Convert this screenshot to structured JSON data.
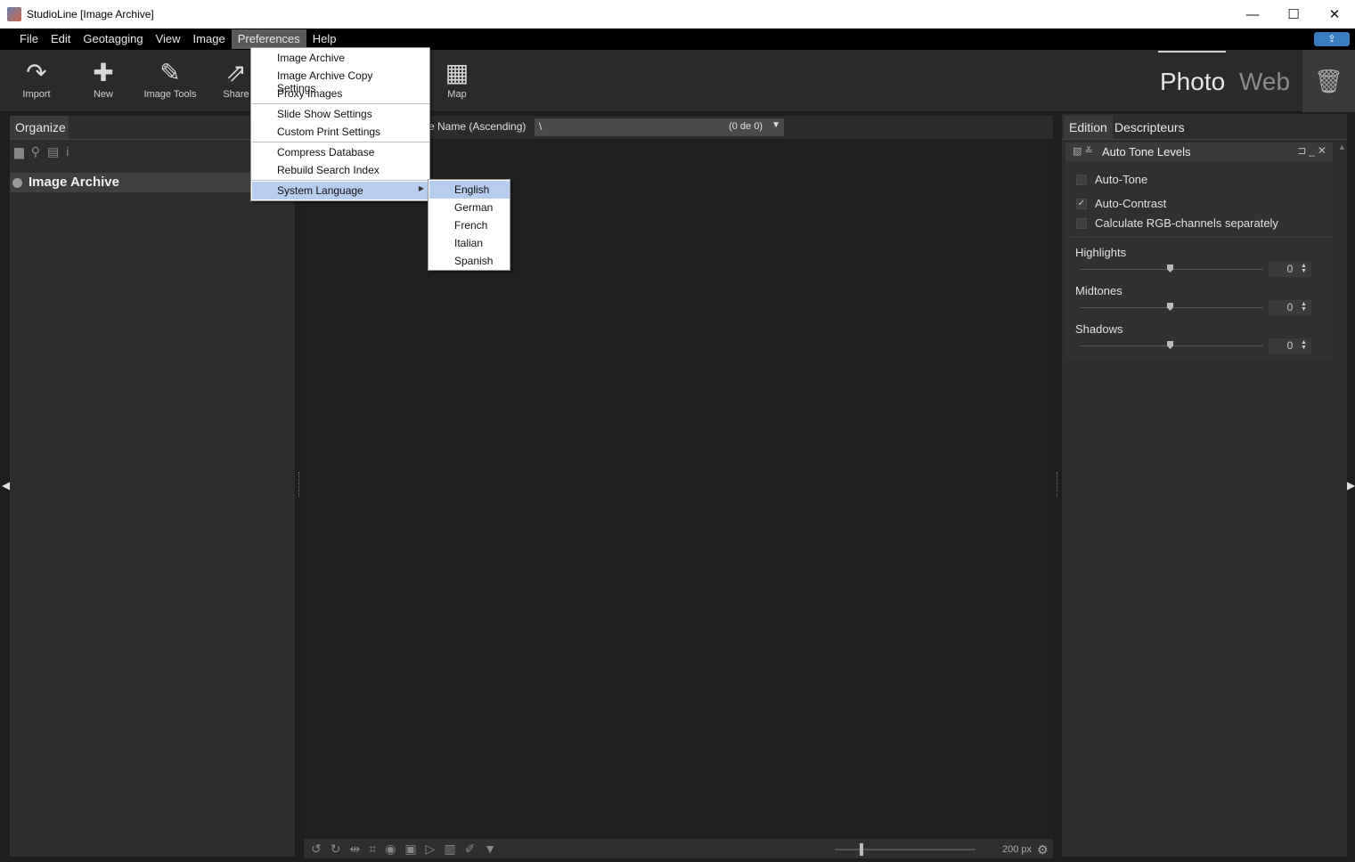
{
  "window": {
    "title": "StudioLine [Image Archive]",
    "minimize": "—",
    "maximize": "☐",
    "close": "✕"
  },
  "menubar": {
    "items": [
      "File",
      "Edit",
      "Geotagging",
      "View",
      "Image",
      "Preferences",
      "Help"
    ],
    "active": "Preferences"
  },
  "toolbar": {
    "import": "Import",
    "new": "New",
    "image_tools": "Image Tools",
    "share": "Share",
    "map": "Map",
    "mode_photo": "Photo",
    "mode_web": "Web"
  },
  "left_panel": {
    "tab": "Organize",
    "tree_item": "Image Archive"
  },
  "center": {
    "sort": "e Name (Ascending)",
    "path": "\\",
    "count": "(0 de 0)",
    "zoom": "200 px"
  },
  "right_panel": {
    "tabs": [
      "Edition",
      "Descripteurs"
    ],
    "module_title": "Auto Tone Levels",
    "checkboxes": [
      {
        "label": "Auto-Tone",
        "checked": false
      },
      {
        "label": "Auto-Contrast",
        "checked": true
      },
      {
        "label": "Calculate RGB-channels separately",
        "checked": false
      }
    ],
    "sliders": [
      {
        "label": "Highlights",
        "value": "0"
      },
      {
        "label": "Midtones",
        "value": "0"
      },
      {
        "label": "Shadows",
        "value": "0"
      }
    ]
  },
  "preferences_menu": {
    "items": [
      "Image Archive",
      "Image Archive Copy Settings",
      "Proxy Images",
      "Slide Show Settings",
      "Custom Print Settings",
      "Compress Database",
      "Rebuild Search Index",
      "System Language"
    ],
    "highlighted": "System Language"
  },
  "language_submenu": {
    "items": [
      "English",
      "German",
      "French",
      "Italian",
      "Spanish"
    ],
    "highlighted": "English"
  },
  "colors": {
    "menu_highlight": "#b6cdf0",
    "background": "#1e1e1e",
    "panel": "#2e2e2e"
  }
}
